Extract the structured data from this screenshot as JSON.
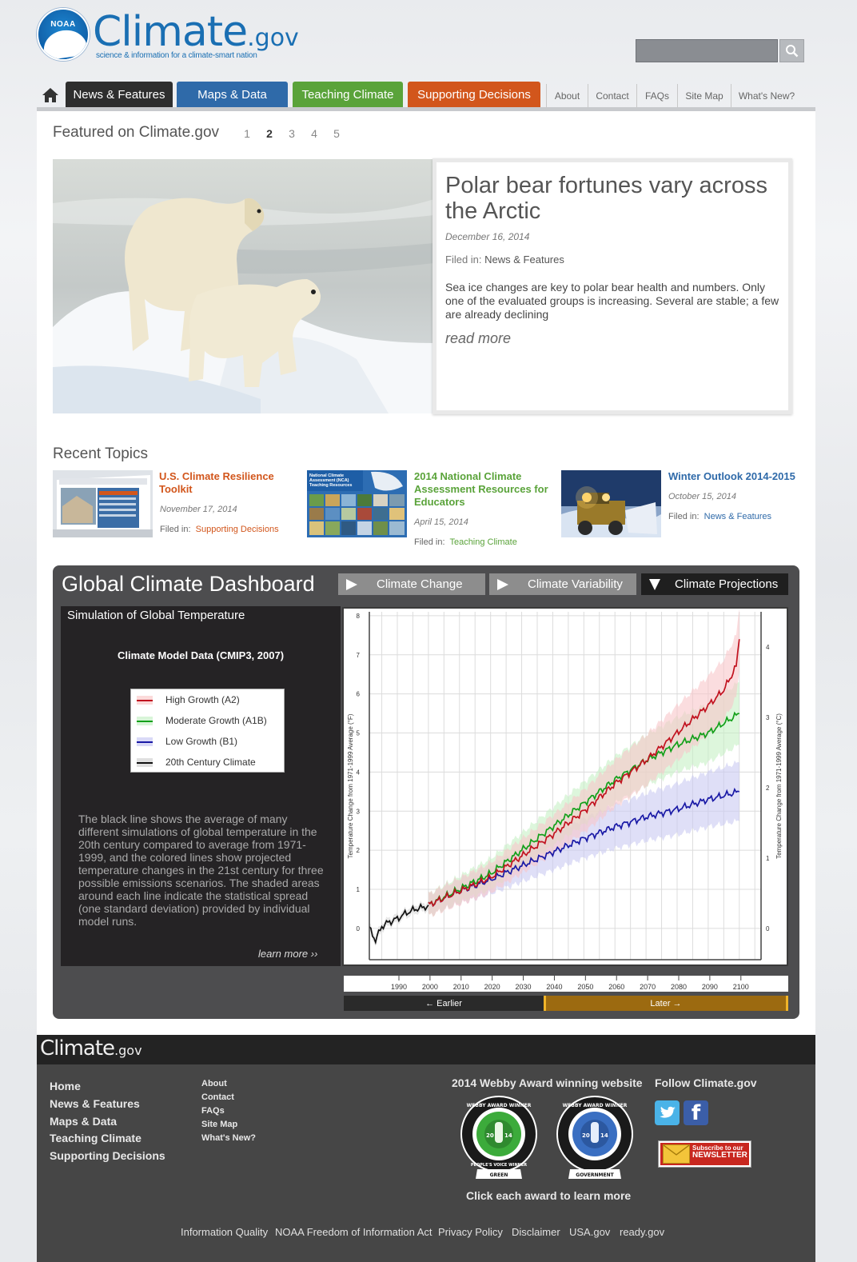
{
  "header": {
    "logo_badge": "NOAA",
    "logo_word": "Climate",
    "logo_suffix": ".gov",
    "tagline": "science & information for a climate-smart nation",
    "search_placeholder": ""
  },
  "nav": {
    "home_icon": "home-icon",
    "tabs": [
      {
        "label": "News & Features",
        "color": "#2e2e2e"
      },
      {
        "label": "Maps & Data",
        "color": "#2f6aa9"
      },
      {
        "label": "Teaching Climate",
        "color": "#5aa33a"
      },
      {
        "label": "Supporting Decisions",
        "color": "#d2561c"
      }
    ],
    "utility_links": [
      "About",
      "Contact",
      "FAQs",
      "Site Map",
      "What's New?"
    ]
  },
  "featured": {
    "heading": "Featured on Climate.gov",
    "pages": [
      "1",
      "2",
      "3",
      "4",
      "5"
    ],
    "active_page": "2",
    "title": "Polar bear fortunes vary across the Arctic",
    "date": "December 16, 2014",
    "filed_label": "Filed in:",
    "filed_value": "News & Features",
    "summary": "Sea ice changes are key to polar bear health and numbers.  Only one of the evaluated groups is increasing. Several are stable; a few are already declining",
    "read_more": "read more"
  },
  "recent": {
    "heading": "Recent Topics",
    "items": [
      {
        "title": "U.S. Climate Resilience Toolkit",
        "date": "November 17, 2014",
        "filed_label": "Filed in:",
        "filed_value": "Supporting Decisions",
        "color": "#d2561c",
        "thumb_caption": ""
      },
      {
        "title": "2014 National Climate Assessment Resources for Educators",
        "date": "April 15, 2014",
        "filed_label": "Filed in:",
        "filed_value": "Teaching Climate",
        "color": "#5aa33a",
        "thumb_caption": "National Climate Assessment (NCA) Teaching Resources"
      },
      {
        "title": "Winter Outlook 2014-2015",
        "date": "October 15, 2014",
        "filed_label": "Filed in:",
        "filed_value": "News & Features",
        "color": "#2f6aa9",
        "thumb_caption": ""
      }
    ]
  },
  "dashboard": {
    "title": "Global Climate Dashboard",
    "tabs": [
      "Climate Change",
      "Climate Variability",
      "Climate Projections"
    ],
    "active_tab": "Climate Projections",
    "panel_title": "Simulation of Global Temperature",
    "model_title": "Climate Model Data (CMIP3, 2007)",
    "legend": [
      {
        "label": "High Growth (A2)",
        "color": "#c1121f"
      },
      {
        "label": "Moderate Growth (A1B)",
        "color": "#13a01a"
      },
      {
        "label": "Low Growth (B1)",
        "color": "#1a1aa6"
      },
      {
        "label": "20th Century Climate",
        "color": "#111111"
      }
    ],
    "description": "The black line shows the average of many different simulations of global temperature in the 20th century compared to average from 1971-1999, and the colored lines show projected temperature changes in the 21st century for three possible emissions scenarios. The shaded areas around each line indicate the statistical spread (one standard deviation) provided by individual model runs.",
    "learn_more": "learn more ››",
    "timeline_earlier": "Earlier",
    "timeline_later": "Later"
  },
  "chart_data": {
    "type": "line",
    "title": "",
    "xlabel": "",
    "ylabel": "Temperature Change from 1971-1999 Average (°F)",
    "ylabel_right": "Temperature Change from 1971-1999 Average (°C)",
    "xlim": [
      1981,
      2107
    ],
    "ylim": [
      -0.8,
      8.1
    ],
    "y_ticks_left": [
      "0",
      "1",
      "2",
      "3",
      "4",
      "5",
      "6",
      "7",
      "8"
    ],
    "y_ticks_right": [
      "0",
      "1",
      "2",
      "3",
      "4"
    ],
    "x_ticks": [
      "1990",
      "2000",
      "2010",
      "2020",
      "2030",
      "2040",
      "2050",
      "2060",
      "2070",
      "2080",
      "2090",
      "2100"
    ],
    "grid": true,
    "series": [
      {
        "name": "20th Century Climate",
        "x": [
          1981,
          1983,
          1985,
          1987,
          1990,
          1993,
          1996,
          1999,
          2000
        ],
        "values": [
          0.0,
          -0.3,
          0.05,
          0.15,
          0.25,
          0.4,
          0.5,
          0.55,
          0.6
        ],
        "spread": 0.3
      },
      {
        "name": "High Growth (A2)",
        "x": [
          2000,
          2010,
          2020,
          2030,
          2040,
          2050,
          2060,
          2070,
          2080,
          2090,
          2095,
          2099,
          2100
        ],
        "values": [
          0.6,
          0.95,
          1.3,
          1.85,
          2.4,
          3.0,
          3.7,
          4.3,
          5.0,
          5.7,
          6.1,
          6.7,
          7.4
        ],
        "spread": 0.8
      },
      {
        "name": "Moderate Growth (A1B)",
        "x": [
          2000,
          2010,
          2020,
          2030,
          2040,
          2050,
          2060,
          2070,
          2080,
          2090,
          2100
        ],
        "values": [
          0.6,
          1.0,
          1.4,
          2.0,
          2.6,
          3.2,
          3.8,
          4.3,
          4.7,
          5.0,
          5.5
        ],
        "spread": 0.8
      },
      {
        "name": "Low Growth (B1)",
        "x": [
          2000,
          2010,
          2020,
          2030,
          2040,
          2050,
          2060,
          2070,
          2080,
          2090,
          2100
        ],
        "values": [
          0.6,
          0.95,
          1.25,
          1.6,
          1.95,
          2.3,
          2.6,
          2.85,
          3.05,
          3.3,
          3.5
        ],
        "spread": 0.75
      }
    ]
  },
  "footer": {
    "logo_word": "Climate",
    "logo_suffix": ".gov",
    "main_links": [
      "Home",
      "News & Features",
      "Maps & Data",
      "Teaching Climate",
      "Supporting Decisions"
    ],
    "sub_links": [
      "About",
      "Contact",
      "FAQs",
      "Site Map",
      "What's New?"
    ],
    "webby_heading": "2014 Webby Award winning website",
    "follow_heading": "Follow Climate.gov",
    "award_caption": "Click each award to learn more",
    "awards": [
      {
        "ring_text": "WEBBY AWARD WINNER",
        "year": "2014",
        "tag": "GREEN",
        "ribbon": "PEOPLE'S VOICE WINNER",
        "color": "#3cab3b"
      },
      {
        "ring_text": "WEBBY AWARD WINNER",
        "year": "2014",
        "tag": "GOVERNMENT",
        "ribbon": "",
        "color": "#3a6fc2"
      }
    ],
    "newsletter_line1": "Subscribe to our",
    "newsletter_line2": "NEWSLETTER",
    "bottom_links": [
      "Information Quality",
      "NOAA Freedom of Information Act",
      "Privacy Policy",
      "Disclaimer",
      "USA.gov",
      "ready.gov"
    ]
  }
}
